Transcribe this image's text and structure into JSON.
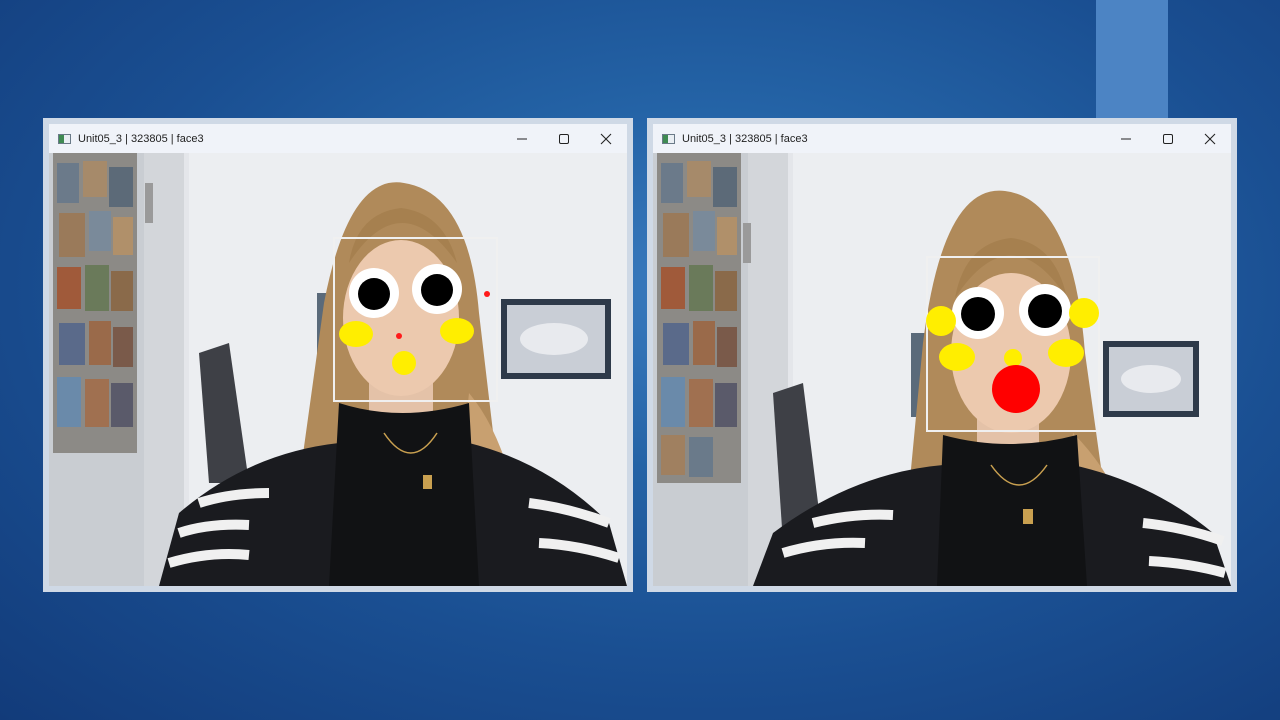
{
  "slide": {
    "accent_color": "#4c84c4",
    "background_color": "#1a4f92"
  },
  "windows": [
    {
      "title": "Unit05_3 | 323805 | face3",
      "controls": [
        "minimize-icon",
        "maximize-icon",
        "close-icon"
      ],
      "overlay": {
        "face_box": true,
        "eyes": 2,
        "cheeks": "yellow",
        "nose": "yellow",
        "landmark_dots": "red"
      }
    },
    {
      "title": "Unit05_3 | 323805 | face3",
      "controls": [
        "minimize-icon",
        "maximize-icon",
        "close-icon"
      ],
      "overlay": {
        "face_box": true,
        "eyes": 2,
        "cheeks": "yellow",
        "ears": "yellow",
        "nose": "yellow",
        "mouth": "red"
      }
    }
  ]
}
